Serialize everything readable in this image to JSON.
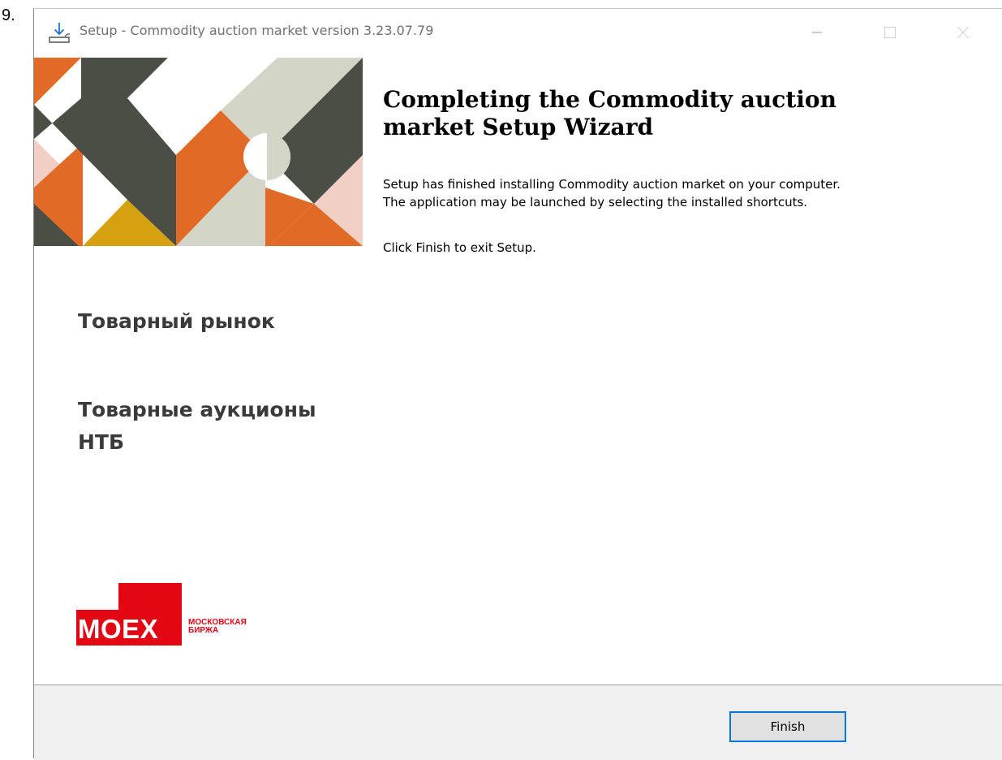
{
  "step_number": "9.",
  "window": {
    "title": "Setup - Commodity auction market  version 3.23.07.79",
    "controls": {
      "minimize": "minimize",
      "maximize": "maximize",
      "close": "close"
    }
  },
  "sidebar": {
    "title_1": "Товарный рынок",
    "title_2": "Товарные аукционы НТБ",
    "logo": {
      "word": "MOEX",
      "subtitle_line1": "МОСКОВСКАЯ",
      "subtitle_line2": "БИРЖА"
    }
  },
  "main": {
    "heading": "Completing the Commodity auction market  Setup Wizard",
    "body_line1": "Setup has finished installing Commodity auction market  on your computer.",
    "body_line2": "The application may be launched by selecting the installed shortcuts.",
    "finish_hint": "Click Finish to exit Setup."
  },
  "footer": {
    "finish_label": "Finish"
  },
  "colors": {
    "orange": "#e06a26",
    "dark_olive": "#4a4e45",
    "pale_green": "#d3d6c6",
    "pink": "#f2cfc4",
    "mustard": "#d6a110",
    "moex_red": "#e30613",
    "button_focus": "#0078d7"
  }
}
